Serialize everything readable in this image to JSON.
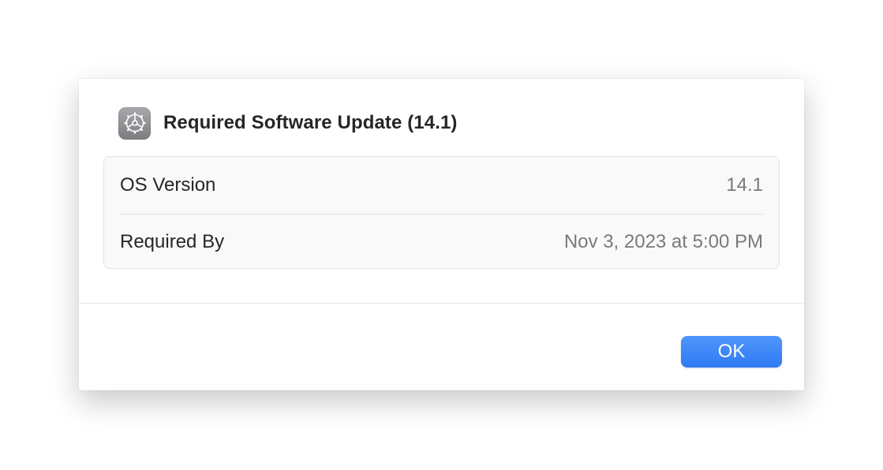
{
  "dialog": {
    "icon": "settings-gear-icon",
    "title": "Required Software Update (14.1)",
    "rows": [
      {
        "label": "OS Version",
        "value": "14.1"
      },
      {
        "label": "Required By",
        "value": "Nov 3, 2023 at 5:00 PM"
      }
    ],
    "ok_label": "OK"
  },
  "colors": {
    "accent": "#3b82f6",
    "title_text": "#262626",
    "value_text": "#7a7a7a",
    "icon_bg": "#8e8e93"
  }
}
